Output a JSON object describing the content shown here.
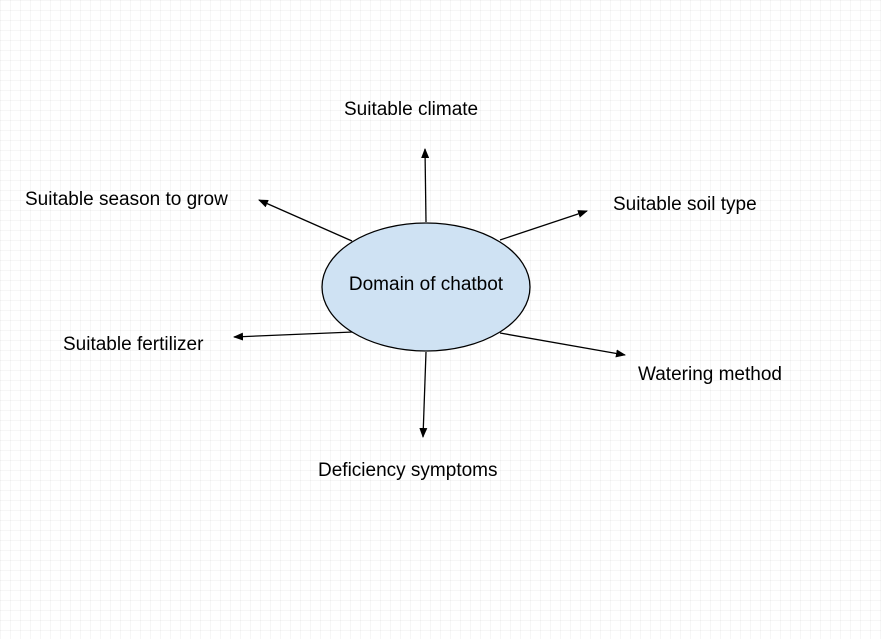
{
  "colors": {
    "node_fill": "#cfe2f3",
    "stroke": "#000000",
    "text": "#000000"
  },
  "center_node": {
    "label": "Domain of chatbot"
  },
  "branches": [
    {
      "id": "climate",
      "label": "Suitable climate"
    },
    {
      "id": "soil",
      "label": "Suitable soil type"
    },
    {
      "id": "watering",
      "label": "Watering method"
    },
    {
      "id": "deficiency",
      "label": "Deficiency symptoms"
    },
    {
      "id": "fertilizer",
      "label": "Suitable fertilizer"
    },
    {
      "id": "season",
      "label": "Suitable season to grow"
    }
  ]
}
